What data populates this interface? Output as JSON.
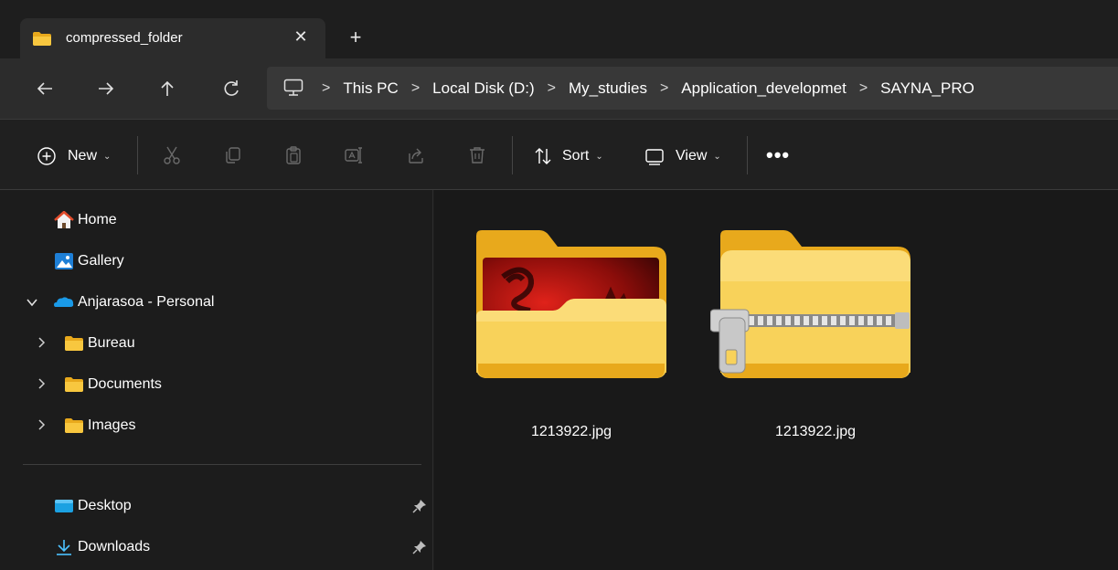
{
  "window": {
    "tab_title": "compressed_folder",
    "tab_close": "✕",
    "tab_new": "+"
  },
  "address": {
    "segments": [
      "This PC",
      "Local Disk (D:)",
      "My_studies",
      "Application_developmet",
      "SAYNA_PRO"
    ],
    "separator": ">"
  },
  "toolbar": {
    "new_label": "New",
    "sort_label": "Sort",
    "view_label": "View",
    "more_label": "•••",
    "caret": "⌄"
  },
  "sidebar": {
    "items": [
      {
        "label": "Home",
        "icon": "home-icon"
      },
      {
        "label": "Gallery",
        "icon": "gallery-icon"
      },
      {
        "label": "Anjarasoa - Personal",
        "icon": "onedrive-cloud-icon",
        "expanded": true
      },
      {
        "label": "Bureau",
        "icon": "folder-icon"
      },
      {
        "label": "Documents",
        "icon": "folder-icon"
      },
      {
        "label": "Images",
        "icon": "folder-icon"
      },
      {
        "label": "Desktop",
        "icon": "desktop-icon",
        "pinned": true
      },
      {
        "label": "Downloads",
        "icon": "download-icon",
        "pinned": true
      }
    ]
  },
  "content": {
    "files": [
      {
        "name": "1213922.jpg",
        "icon": "folder-with-image-thumbnail-icon"
      },
      {
        "name": "1213922.jpg",
        "icon": "zip-folder-icon"
      }
    ]
  },
  "colors": {
    "background": "#1c1c1c",
    "address_bar": "#383838",
    "folder_yellow": "#f8c73f",
    "folder_back": "#e8a91c",
    "onedrive_blue": "#1a9ae8",
    "accent_download": "#4cc2ff"
  }
}
